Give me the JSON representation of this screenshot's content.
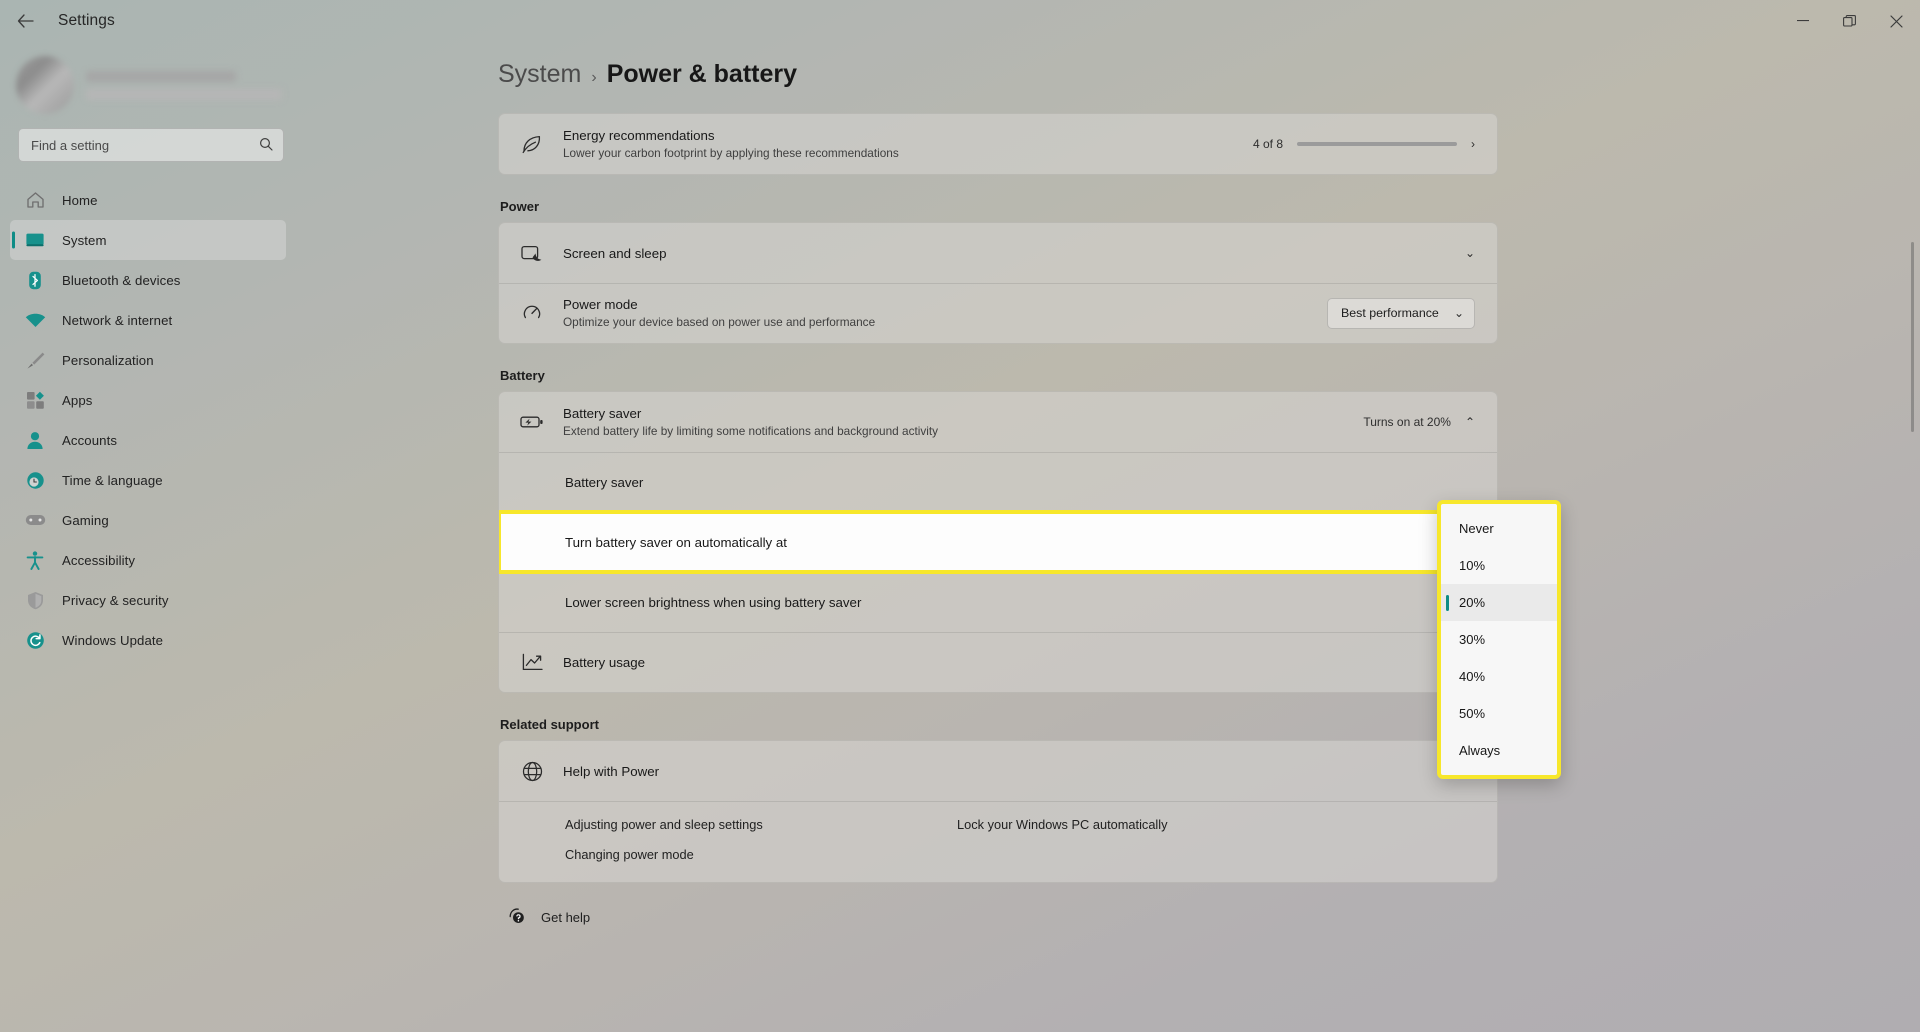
{
  "titlebar": {
    "back_label": "←",
    "title": "Settings",
    "minimize": "—",
    "maximize": "❐",
    "close": "✕"
  },
  "sidebar": {
    "search_placeholder": "Find a setting",
    "search_value": "",
    "search_icon": "search-icon",
    "items": [
      {
        "label": "Home",
        "icon": "home-icon",
        "selected": false
      },
      {
        "label": "System",
        "icon": "system-icon",
        "selected": true
      },
      {
        "label": "Bluetooth & devices",
        "icon": "bluetooth-icon",
        "selected": false
      },
      {
        "label": "Network & internet",
        "icon": "wifi-icon",
        "selected": false
      },
      {
        "label": "Personalization",
        "icon": "brush-icon",
        "selected": false
      },
      {
        "label": "Apps",
        "icon": "apps-icon",
        "selected": false
      },
      {
        "label": "Accounts",
        "icon": "person-icon",
        "selected": false
      },
      {
        "label": "Time & language",
        "icon": "clock-icon",
        "selected": false
      },
      {
        "label": "Gaming",
        "icon": "gamepad-icon",
        "selected": false
      },
      {
        "label": "Accessibility",
        "icon": "accessibility-icon",
        "selected": false
      },
      {
        "label": "Privacy & security",
        "icon": "shield-icon",
        "selected": false
      },
      {
        "label": "Windows Update",
        "icon": "update-icon",
        "selected": false
      }
    ]
  },
  "breadcrumb": {
    "parent": "System",
    "separator": "›",
    "current": "Power & battery"
  },
  "energy": {
    "title": "Energy recommendations",
    "subtitle": "Lower your carbon footprint by applying these recommendations",
    "count_label": "4 of 8",
    "progress_percent": 50,
    "chevron": "›"
  },
  "power_section": {
    "heading": "Power",
    "rows": [
      {
        "title": "Screen and sleep",
        "subtitle": "",
        "value": "",
        "chevron": "⌄"
      },
      {
        "title": "Power mode",
        "subtitle": "Optimize your device based on power use and performance",
        "value": "Best performance",
        "chevron": "⌄"
      }
    ]
  },
  "battery_section": {
    "heading": "Battery",
    "saver_title": "Battery saver",
    "saver_subtitle": "Extend battery life by limiting some notifications and background activity",
    "saver_value": "Turns on at 20%",
    "saver_chevron": "⌃",
    "sub_rows": [
      {
        "title": "Battery saver"
      },
      {
        "title": "Turn battery saver on automatically at"
      },
      {
        "title": "Lower screen brightness when using battery saver"
      }
    ],
    "usage_title": "Battery usage",
    "usage_chevron": "⌄"
  },
  "dropdown": {
    "selected": "20%",
    "options": [
      {
        "label": "Never",
        "selected": false
      },
      {
        "label": "10%",
        "selected": false
      },
      {
        "label": "20%",
        "selected": true
      },
      {
        "label": "30%",
        "selected": false
      },
      {
        "label": "40%",
        "selected": false
      },
      {
        "label": "50%",
        "selected": false
      },
      {
        "label": "Always",
        "selected": false
      }
    ]
  },
  "related_support": {
    "heading": "Related support",
    "help_title": "Help with Power",
    "help_chevron": "⌃",
    "links_left": [
      "Adjusting power and sleep settings",
      "Changing power mode"
    ],
    "links_right": [
      "Lock your Windows PC automatically"
    ]
  },
  "footer": {
    "get_help": "Get help",
    "get_help_icon": "help-icon"
  },
  "colors": {
    "accent_teal": "#0e8c86",
    "highlight_yellow": "#f7e72b",
    "progress_fill": "#0c7f7b"
  }
}
